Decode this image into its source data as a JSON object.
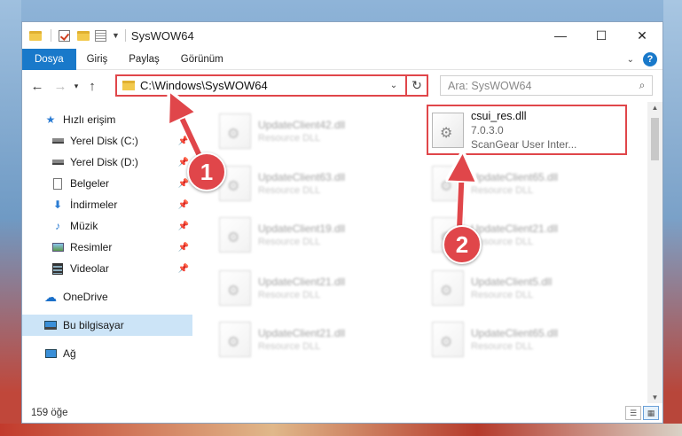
{
  "window": {
    "title": "SysWOW64",
    "minimize_glyph": "—",
    "maximize_glyph": "☐",
    "close_glyph": "✕"
  },
  "ribbon": {
    "tabs": [
      {
        "label": "Dosya",
        "active": true
      },
      {
        "label": "Giriş"
      },
      {
        "label": "Paylaş"
      },
      {
        "label": "Görünüm"
      }
    ],
    "help_glyph": "?"
  },
  "address": {
    "path": "C:\\Windows\\SysWOW64",
    "search_placeholder": "Ara: SysWOW64"
  },
  "sidebar": {
    "items": [
      {
        "label": "Hızlı erişim",
        "icon": "star-icon"
      },
      {
        "label": "Yerel Disk (C:)",
        "icon": "drive-icon",
        "pinned": true
      },
      {
        "label": "Yerel Disk (D:)",
        "icon": "drive-icon",
        "pinned": true
      },
      {
        "label": "Belgeler",
        "icon": "document-icon",
        "pinned": true
      },
      {
        "label": "İndirmeler",
        "icon": "download-icon",
        "pinned": true
      },
      {
        "label": "Müzik",
        "icon": "music-icon",
        "pinned": true
      },
      {
        "label": "Resimler",
        "icon": "pictures-icon",
        "pinned": true
      },
      {
        "label": "Videolar",
        "icon": "video-icon",
        "pinned": true
      },
      {
        "label": "OneDrive",
        "icon": "cloud-icon"
      },
      {
        "label": "Bu bilgisayar",
        "icon": "computer-icon",
        "selected": true
      },
      {
        "label": "Ağ",
        "icon": "network-icon"
      }
    ]
  },
  "files": {
    "highlighted": {
      "name": "csui_res.dll",
      "version": "7.0.3.0",
      "description": "ScanGear User Inter..."
    },
    "left_column": [
      {
        "name": "UpdateClient42.dll",
        "type": "Resource DLL"
      },
      {
        "name": "UpdateClient63.dll",
        "type": "Resource DLL"
      },
      {
        "name": "UpdateClient19.dll",
        "type": "Resource DLL"
      },
      {
        "name": "UpdateClient21.dll",
        "type": "Resource DLL"
      },
      {
        "name": "UpdateClient21.dll",
        "type": "Resource DLL"
      }
    ],
    "right_column": [
      {
        "name": "UpdateClient65.dll",
        "type": "Resource DLL"
      },
      {
        "name": "UpdateClient21.dll",
        "type": "Resource DLL"
      },
      {
        "name": "UpdateClient5.dll",
        "type": "Resource DLL"
      },
      {
        "name": "UpdateClient65.dll",
        "type": "Resource DLL"
      }
    ]
  },
  "status": {
    "count_text": "159 öğe"
  },
  "annotations": {
    "badge1": "1",
    "badge2": "2",
    "color": "#e0464a"
  }
}
